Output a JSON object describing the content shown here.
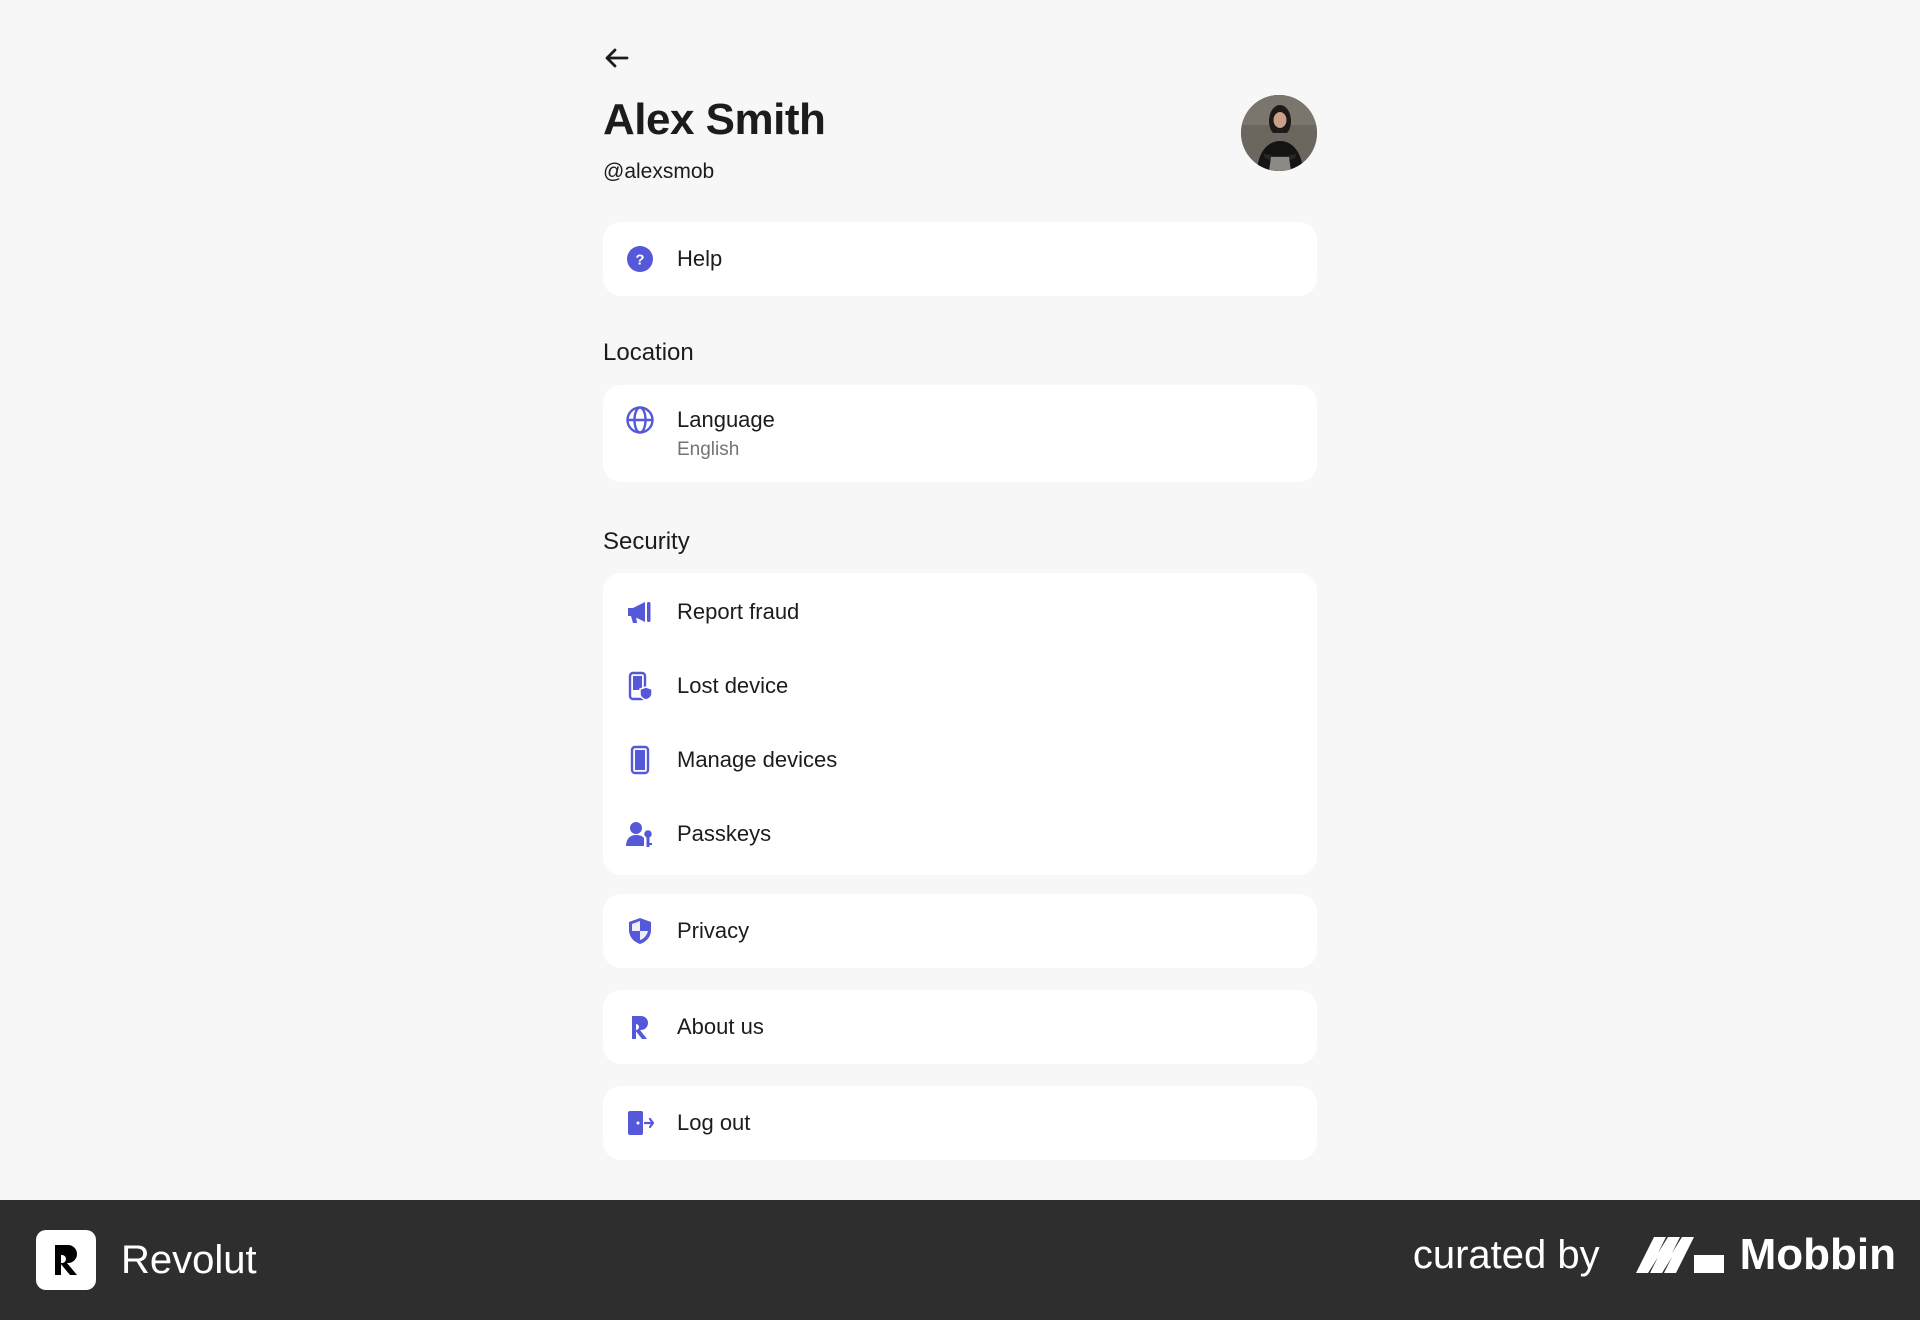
{
  "profile": {
    "back_icon": "arrow-left-icon",
    "name": "Alex Smith",
    "handle": "@alexsmob",
    "avatar_icon": "user-photo"
  },
  "help": {
    "label": "Help",
    "icon": "question-circle-icon"
  },
  "location": {
    "title": "Location",
    "language": {
      "label": "Language",
      "value": "English",
      "icon": "globe-icon"
    }
  },
  "security": {
    "title": "Security",
    "items": [
      {
        "label": "Report fraud",
        "icon": "megaphone-icon"
      },
      {
        "label": "Lost device",
        "icon": "phone-shield-icon"
      },
      {
        "label": "Manage devices",
        "icon": "phone-icon"
      },
      {
        "label": "Passkeys",
        "icon": "user-key-icon"
      }
    ]
  },
  "privacy": {
    "label": "Privacy",
    "icon": "shield-icon"
  },
  "about": {
    "label": "About us",
    "icon": "revolut-r-icon"
  },
  "logout": {
    "label": "Log out",
    "icon": "door-exit-icon"
  },
  "footer": {
    "brand": "Revolut",
    "curated_by": "curated by",
    "curator": "Mobbin"
  },
  "colors": {
    "accent": "#5458d9",
    "background": "#f7f7f7",
    "card": "#ffffff",
    "footer": "#2e2e2e"
  }
}
